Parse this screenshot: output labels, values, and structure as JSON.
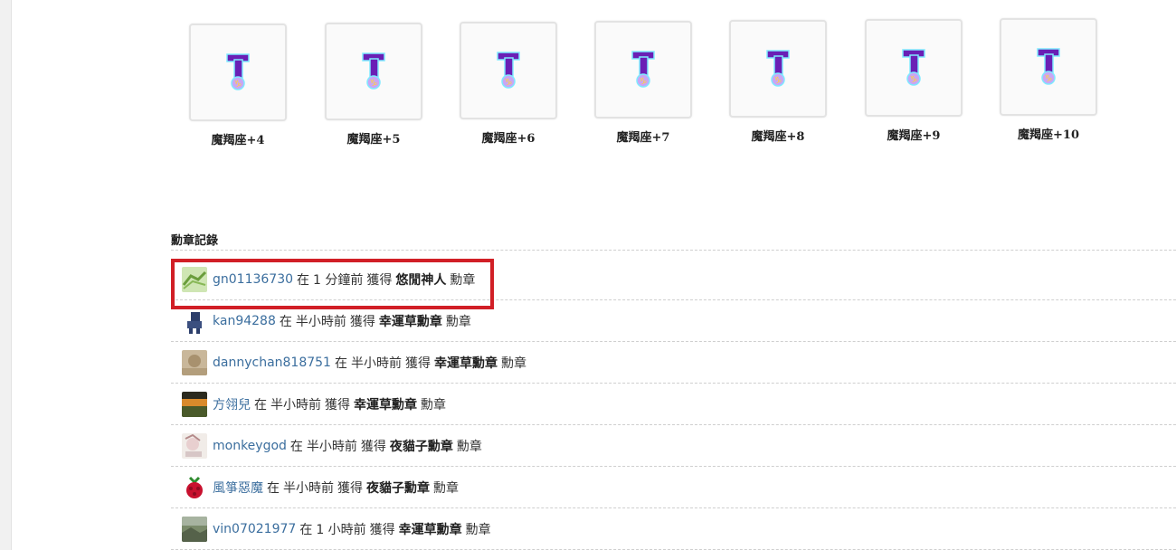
{
  "badges": [
    {
      "name": "魔羯座+4",
      "icon": "capricorn-badge-icon"
    },
    {
      "name": "魔羯座+5",
      "icon": "capricorn-badge-icon"
    },
    {
      "name": "魔羯座+6",
      "icon": "capricorn-badge-icon"
    },
    {
      "name": "魔羯座+7",
      "icon": "capricorn-badge-icon"
    },
    {
      "name": "魔羯座+8",
      "icon": "capricorn-badge-icon"
    },
    {
      "name": "魔羯座+9",
      "icon": "capricorn-badge-icon"
    },
    {
      "name": "魔羯座+10",
      "icon": "capricorn-badge-icon"
    }
  ],
  "records": {
    "title": "勳章記錄",
    "items": [
      {
        "user": "gn01136730",
        "at": "在",
        "time": "1 分鐘前",
        "got": "獲得",
        "badge": "悠閒神人",
        "suffix": "勳章",
        "avatar": "green-map-avatar"
      },
      {
        "user": "kan94288",
        "at": "在",
        "time": "半小時前",
        "got": "獲得",
        "badge": "幸運草勳章",
        "suffix": "勳章",
        "avatar": "robot-avatar"
      },
      {
        "user": "dannychan818751",
        "at": "在",
        "time": "半小時前",
        "got": "獲得",
        "badge": "幸運草勳章",
        "suffix": "勳章",
        "avatar": "beige-photo-avatar"
      },
      {
        "user": "方翎兒",
        "at": "在",
        "time": "半小時前",
        "got": "獲得",
        "badge": "幸運草勳章",
        "suffix": "勳章",
        "avatar": "sunset-avatar"
      },
      {
        "user": "monkeygod",
        "at": "在",
        "time": "半小時前",
        "got": "獲得",
        "badge": "夜貓子勳章",
        "suffix": "勳章",
        "avatar": "anime-avatar"
      },
      {
        "user": "風箏惡魔",
        "at": "在",
        "time": "半小時前",
        "got": "獲得",
        "badge": "夜貓子勳章",
        "suffix": "勳章",
        "avatar": "raspberry-avatar"
      },
      {
        "user": "vin07021977",
        "at": "在",
        "time": "1 小時前",
        "got": "獲得",
        "badge": "幸運草勳章",
        "suffix": "勳章",
        "avatar": "landscape-avatar"
      }
    ]
  },
  "colors": {
    "link": "#3b6e9e",
    "highlight": "#d11f26",
    "badge_purple": "#6a1fb5",
    "badge_glow": "#7fe9ff"
  }
}
